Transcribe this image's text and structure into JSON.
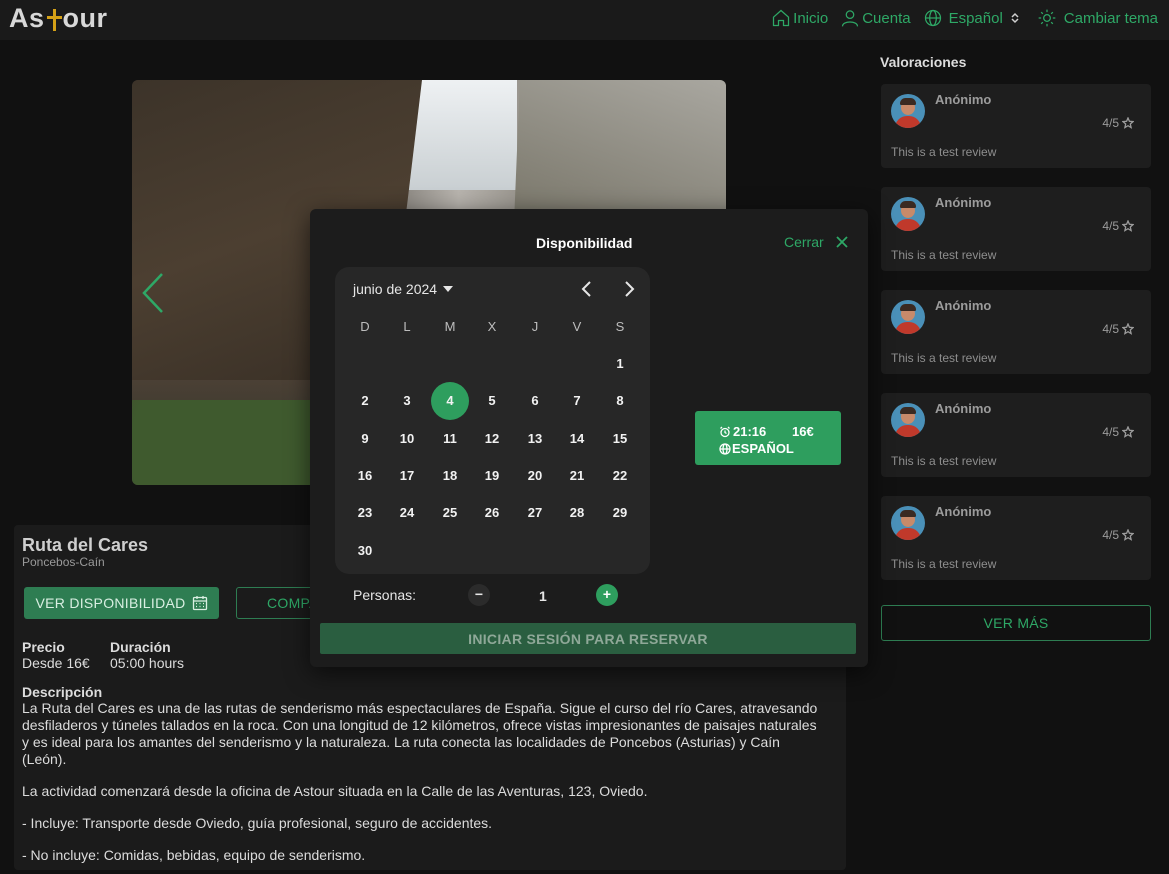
{
  "header": {
    "logo_left": "As",
    "logo_right": "our",
    "nav": {
      "home": "Inicio",
      "account": "Cuenta",
      "language": "Español",
      "theme": "Cambiar tema"
    }
  },
  "tour": {
    "title": "Ruta del Cares",
    "subtitle": "Poncebos-Caín",
    "availability_button": "VER DISPONIBILIDAD",
    "compare_button": "COMPARTIR",
    "price_label": "Precio",
    "price_value": "Desde 16€",
    "duration_label": "Duración",
    "duration_value": "05:00 hours",
    "description_label": "Descripción",
    "description": [
      "La Ruta del Cares es una de las rutas de senderismo más espectaculares de España. Sigue el curso del río Cares, atravesando desfiladeros y túneles tallados en la roca. Con una longitud de 12 kilómetros, ofrece vistas impresionantes de paisajes naturales y es ideal para los amantes del senderismo y la naturaleza. La ruta conecta las localidades de Poncebos (Asturias) y Caín (León).",
      "La actividad comenzará desde la oficina de Astour situada en la Calle de las Aventuras, 123, Oviedo.",
      "- Incluye: Transporte desde Oviedo, guía profesional, seguro de accidentes.",
      "- No incluye: Comidas, bebidas, equipo de senderismo."
    ]
  },
  "reviews": {
    "title": "Valoraciones",
    "items": [
      {
        "name": "Anónimo",
        "score": "4/5",
        "text": "This is a test review"
      },
      {
        "name": "Anónimo",
        "score": "4/5",
        "text": "This is a test review"
      },
      {
        "name": "Anónimo",
        "score": "4/5",
        "text": "This is a test review"
      },
      {
        "name": "Anónimo",
        "score": "4/5",
        "text": "This is a test review"
      },
      {
        "name": "Anónimo",
        "score": "4/5",
        "text": "This is a test review"
      }
    ],
    "more_button": "VER MÁS"
  },
  "modal": {
    "title": "Disponibilidad",
    "close_label": "Cerrar",
    "calendar": {
      "month": "junio de 2024",
      "weekdays": [
        "D",
        "L",
        "M",
        "X",
        "J",
        "V",
        "S"
      ],
      "first_weekday_index": 6,
      "days_in_month": 30,
      "selected_day": 4
    },
    "slot": {
      "time": "21:16",
      "price": "16€",
      "language": "ESPAÑOL"
    },
    "persons_label": "Personas:",
    "persons_count": "1",
    "minus": "−",
    "plus": "+",
    "login_button": "INICIAR SESIÓN PARA RESERVAR"
  },
  "colors": {
    "accent": "#2ea866",
    "button_fill": "#2e7d52",
    "selected_day": "#2e9e5e",
    "logo_cross": "#d4a017"
  }
}
